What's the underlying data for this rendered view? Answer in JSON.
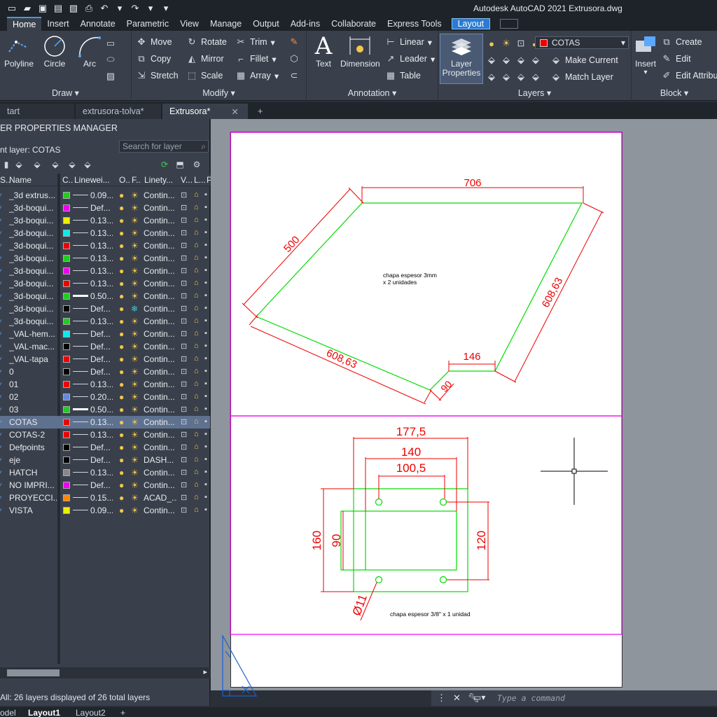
{
  "window": {
    "title": "Autodesk AutoCAD 2021   Extrusora.dwg"
  },
  "ribbon_tabs": [
    "Home",
    "Insert",
    "Annotate",
    "Parametric",
    "View",
    "Manage",
    "Output",
    "Add-ins",
    "Collaborate",
    "Express Tools",
    "Layout"
  ],
  "ribbon": {
    "draw": {
      "title": "Draw",
      "polyline": "Polyline",
      "circle": "Circle",
      "arc": "Arc"
    },
    "modify": {
      "title": "Modify",
      "move": "Move",
      "rotate": "Rotate",
      "trim": "Trim",
      "copy": "Copy",
      "mirror": "Mirror",
      "fillet": "Fillet",
      "stretch": "Stretch",
      "scale": "Scale",
      "array": "Array"
    },
    "annotation": {
      "title": "Annotation",
      "text": "Text",
      "dimension": "Dimension",
      "linear": "Linear",
      "leader": "Leader",
      "table": "Table"
    },
    "layers": {
      "title": "Layers",
      "layer_properties_1": "Layer",
      "layer_properties_2": "Properties",
      "current_layer": "COTAS",
      "current_color": "#ee0000",
      "make_current": "Make Current",
      "match_layer": "Match Layer"
    },
    "block": {
      "title": "Block",
      "insert": "Insert",
      "create": "Create",
      "edit": "Edit",
      "edit_attributes": "Edit Attribu"
    }
  },
  "doc_tabs": {
    "start": "tart",
    "tab1": "extrusora-tolva*",
    "tab2": "Extrusora*"
  },
  "layer_manager": {
    "header": "ER PROPERTIES MANAGER",
    "current": "nt layer: COTAS",
    "search_placeholder": "Search for layer",
    "columns": {
      "s": "S..",
      "name": "Name",
      "c": "C..",
      "lineweight": "Linewei...",
      "o": "O..",
      "f": "F..",
      "linetype": "Linety...",
      "v": "V...",
      "l": "L...",
      "p": "P"
    },
    "layers": [
      {
        "name": "_3d extrus...",
        "color": "#22cc22",
        "lw": "0.09...",
        "lt": "Contin..."
      },
      {
        "name": "_3d-boqui...",
        "color": "#ee00ee",
        "lw": "Def...",
        "lt": "Contin..."
      },
      {
        "name": "_3d-boqui...",
        "color": "#eeee00",
        "lw": "0.13...",
        "lt": "Contin..."
      },
      {
        "name": "_3d-boqui...",
        "color": "#00eeee",
        "lw": "0.13...",
        "lt": "Contin..."
      },
      {
        "name": "_3d-boqui...",
        "color": "#ee0000",
        "lw": "0.13...",
        "lt": "Contin..."
      },
      {
        "name": "_3d-boqui...",
        "color": "#22cc22",
        "lw": "0.13...",
        "lt": "Contin..."
      },
      {
        "name": "_3d-boqui...",
        "color": "#ee00ee",
        "lw": "0.13...",
        "lt": "Contin..."
      },
      {
        "name": "_3d-boqui...",
        "color": "#ee0000",
        "lw": "0.13...",
        "lt": "Contin..."
      },
      {
        "name": "_3d-boqui...",
        "color": "#22cc22",
        "lw": "0.50...",
        "lt": "Contin...",
        "thick": true
      },
      {
        "name": "_3d-boqui...",
        "color": "#000000",
        "lw": "Def...",
        "lt": "Contin...",
        "frozen": true
      },
      {
        "name": "_3d-boqui...",
        "color": "#22cc22",
        "lw": "0.13...",
        "lt": "Contin..."
      },
      {
        "name": "_VAL-hem...",
        "color": "#00eeee",
        "lw": "Def...",
        "lt": "Contin..."
      },
      {
        "name": "_VAL-mac...",
        "color": "#000000",
        "lw": "Def...",
        "lt": "Contin..."
      },
      {
        "name": "_VAL-tapa",
        "color": "#ee0000",
        "lw": "Def...",
        "lt": "Contin..."
      },
      {
        "name": "0",
        "color": "#000000",
        "lw": "Def...",
        "lt": "Contin..."
      },
      {
        "name": "01",
        "color": "#ee0000",
        "lw": "0.13...",
        "lt": "Contin..."
      },
      {
        "name": "02",
        "color": "#6688dd",
        "lw": "0.20...",
        "lt": "Contin..."
      },
      {
        "name": "03",
        "color": "#22cc22",
        "lw": "0.50...",
        "lt": "Contin...",
        "thick": true
      },
      {
        "name": "COTAS",
        "color": "#ee0000",
        "lw": "0.13...",
        "lt": "Contin...",
        "selected": true
      },
      {
        "name": "COTAS-2",
        "color": "#ee0000",
        "lw": "0.13...",
        "lt": "Contin..."
      },
      {
        "name": "Defpoints",
        "color": "#000000",
        "lw": "Def...",
        "lt": "Contin..."
      },
      {
        "name": "eje",
        "color": "#000000",
        "lw": "Def...",
        "lt": "DASH..."
      },
      {
        "name": "HATCH",
        "color": "#888888",
        "lw": "0.13...",
        "lt": "Contin..."
      },
      {
        "name": "NO IMPRI...",
        "color": "#ee00ee",
        "lw": "Def...",
        "lt": "Contin..."
      },
      {
        "name": "PROYECCI...",
        "color": "#ff8800",
        "lw": "0.15...",
        "lt": "ACAD_..."
      },
      {
        "name": "VISTA",
        "color": "#eeee00",
        "lw": "0.09...",
        "lt": "Contin..."
      }
    ],
    "status": "All: 26 layers displayed of 26 total layers"
  },
  "drawing": {
    "dims_top": {
      "d706": "706",
      "d500": "500",
      "d608_right": "608,63",
      "d608_bottom": "608,63",
      "d146": "146",
      "d90": "90"
    },
    "note_top_1": "chapa espesor 3mm",
    "note_top_2": "x 2 unidades",
    "dims_bottom": {
      "d177": "177,5",
      "d140": "140",
      "d100": "100,5",
      "d160": "160",
      "d90": "90",
      "d120": "120",
      "d11": "Ø11"
    },
    "note_bottom": "chapa espesor 3/8\" x 1 unidad"
  },
  "command": {
    "placeholder": "Type a command"
  },
  "layout_tabs": {
    "model": "odel",
    "layout1": "Layout1",
    "layout2": "Layout2"
  }
}
